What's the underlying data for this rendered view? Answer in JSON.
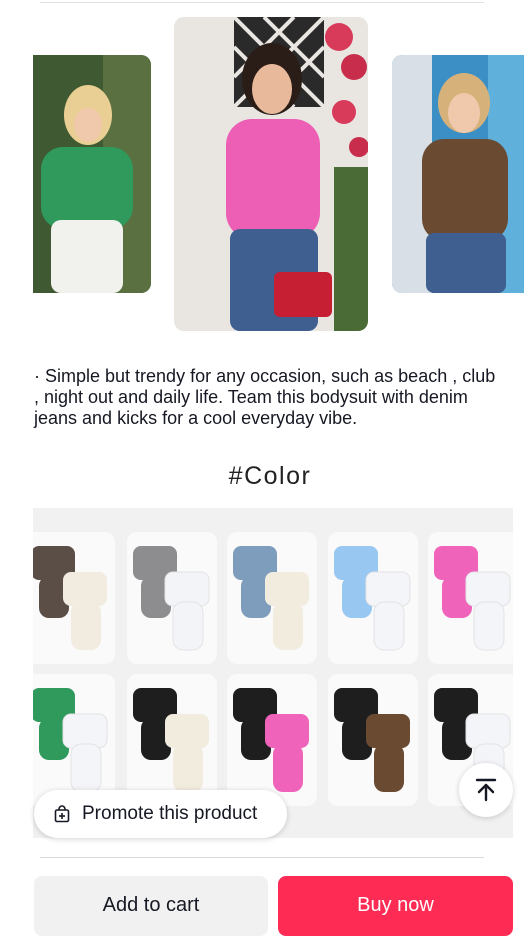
{
  "product": {
    "description": "· Simple but trendy for any occasion, such as beach , club , night out and daily life. Team this bodysuit with denim jeans and kicks for a cool everyday vibe.",
    "color_heading": "#Color"
  },
  "carousel": {
    "photos": [
      {
        "name": "green-bodysuit-photo",
        "color": "#2f9a5c"
      },
      {
        "name": "pink-bodysuit-photo",
        "color": "#ec5fb4"
      },
      {
        "name": "brown-bodysuit-photo",
        "color": "#6b4a32"
      }
    ]
  },
  "swatches": {
    "rows": [
      [
        {
          "colors": [
            "#5b4e47",
            "#f1ebe0"
          ]
        },
        {
          "colors": [
            "#8d8d90",
            "#f3f4f7"
          ]
        },
        {
          "colors": [
            "#7e9dbd",
            "#f2ecdf"
          ]
        },
        {
          "colors": [
            "#98c7f1",
            "#f4f5f8"
          ]
        },
        {
          "colors": [
            "#ef63bb",
            "#f4f5f8"
          ]
        }
      ],
      [
        {
          "colors": [
            "#2f9a5c",
            "#f4f5f8"
          ]
        },
        {
          "colors": [
            "#1e1e1f",
            "#f2ecdf"
          ]
        },
        {
          "colors": [
            "#1e1e1f",
            "#ef63bb"
          ]
        },
        {
          "colors": [
            "#1e1e1f",
            "#6b4a32"
          ]
        },
        {
          "colors": [
            "#1e1e1f",
            "#f4f5f8"
          ]
        }
      ]
    ]
  },
  "promote": {
    "label": "Promote this product"
  },
  "actions": {
    "add_to_cart": "Add to cart",
    "buy_now": "Buy now"
  },
  "colors": {
    "accent": "#fe2c55",
    "secondary_button": "#f1f1f2"
  }
}
